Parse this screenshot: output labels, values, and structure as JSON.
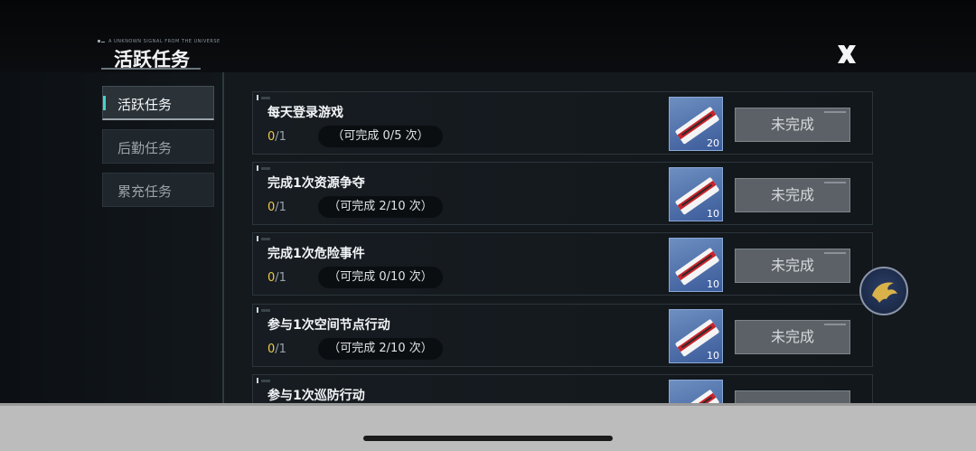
{
  "header": {
    "title": "活跃任务",
    "small_caption": "A UNKNOWN SIGNAL FROM THE UNIVERSE",
    "close_label": "X"
  },
  "sidebar": {
    "items": [
      {
        "label": "活跃任务",
        "active": true
      },
      {
        "label": "后勤任务",
        "active": false
      },
      {
        "label": "累充任务",
        "active": false
      }
    ]
  },
  "tasks": [
    {
      "name": "每天登录游戏",
      "progress_current": "0",
      "progress_total": "/1",
      "limit": "（可完成 0/5 次）",
      "reward_count": "20",
      "status": "未完成"
    },
    {
      "name": "完成1次资源争夺",
      "progress_current": "0",
      "progress_total": "/1",
      "limit": "（可完成 2/10 次）",
      "reward_count": "10",
      "status": "未完成"
    },
    {
      "name": "完成1次危险事件",
      "progress_current": "0",
      "progress_total": "/1",
      "limit": "（可完成 0/10 次）",
      "reward_count": "10",
      "status": "未完成"
    },
    {
      "name": "参与1次空间节点行动",
      "progress_current": "0",
      "progress_total": "/1",
      "limit": "（可完成 2/10 次）",
      "reward_count": "10",
      "status": "未完成"
    },
    {
      "name": "参与1次巡防行动",
      "progress_current": "",
      "progress_total": "",
      "limit": "",
      "reward_count": "",
      "status": ""
    }
  ],
  "icons": {
    "close": "close-x-icon",
    "reward": "ticket-card-icon",
    "float": "phoenix-emblem-icon"
  },
  "colors": {
    "accent": "#45d3c6",
    "progress_current": "#f0c84a",
    "reward_bg": "#3b5a9a"
  }
}
